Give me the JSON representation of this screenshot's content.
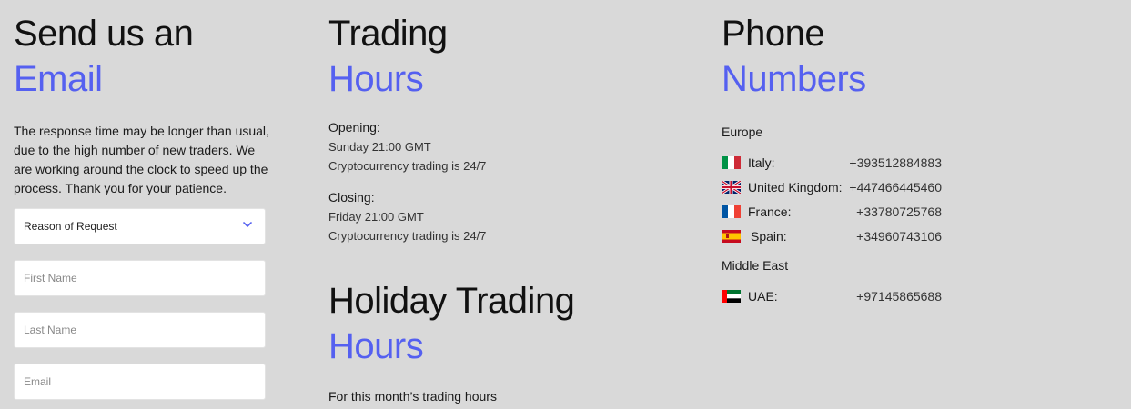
{
  "email_section": {
    "title_line1": "Send us an",
    "title_line2": "Email",
    "description": "The response time may be longer than usual, due to the high number of new traders. We are working around the clock to speed up the process. Thank you for your patience.",
    "reason_select": {
      "selected": "Reason of Request"
    },
    "first_name_placeholder": "First Name",
    "last_name_placeholder": "Last Name",
    "email_placeholder": "Email"
  },
  "trading_hours": {
    "title_line1": "Trading",
    "title_line2": "Hours",
    "opening_label": "Opening:",
    "opening_time": "Sunday 21:00 GMT",
    "opening_note": "Cryptocurrency trading is 24/7",
    "closing_label": "Closing:",
    "closing_time": "Friday 21:00 GMT",
    "closing_note": "Cryptocurrency trading is 24/7"
  },
  "holiday_hours": {
    "title_line1": "Holiday Trading",
    "title_line2": "Hours",
    "note": "For this month’s trading hours"
  },
  "phone_numbers": {
    "title_line1": "Phone",
    "title_line2": "Numbers",
    "regions": [
      {
        "name": "Europe",
        "entries": [
          {
            "country": "Italy:",
            "number": "+393512884883",
            "flag_icon": "italy-flag-icon"
          },
          {
            "country": "United Kingdom:",
            "number": "+447466445460",
            "flag_icon": "uk-flag-icon"
          },
          {
            "country": "France:",
            "number": "+33780725768",
            "flag_icon": "france-flag-icon"
          },
          {
            "country": "Spain:",
            "number": "+34960743106",
            "flag_icon": "spain-flag-icon"
          }
        ]
      },
      {
        "name": "Middle East",
        "entries": [
          {
            "country": "UAE:",
            "number": "+97145865688",
            "flag_icon": "uae-flag-icon"
          }
        ]
      }
    ]
  },
  "colors": {
    "accent": "#5560f0",
    "background": "#d9d9d9"
  }
}
